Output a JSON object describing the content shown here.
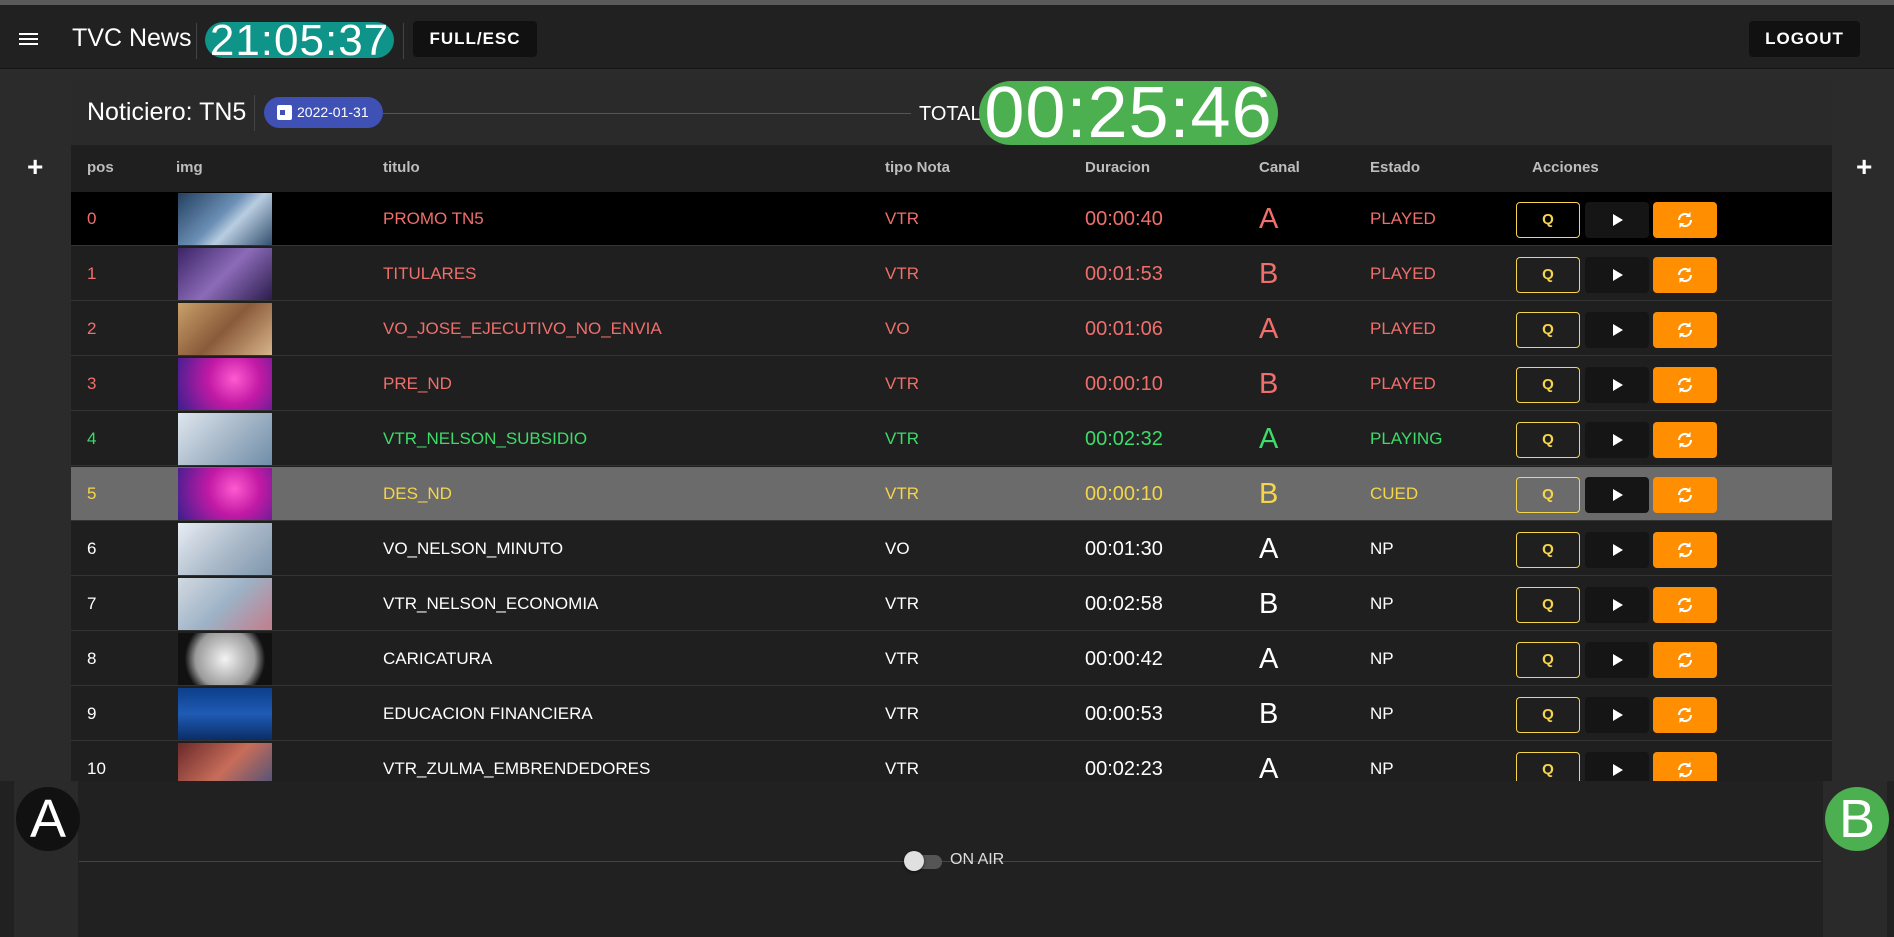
{
  "header": {
    "app_title": "TVC News",
    "clock": "21:05:37",
    "full_button": "FULL/ESC",
    "logout_button": "LOGOUT"
  },
  "side": {
    "add_left": "+",
    "add_right": "+"
  },
  "rundown": {
    "title": "Noticiero: TN5",
    "date": "2022-01-31",
    "total_label": "TOTAL",
    "total_time": "00:25:46",
    "columns": [
      "pos",
      "img",
      "titulo",
      "tipo Nota",
      "Duracion",
      "Canal",
      "Estado",
      "Acciones"
    ],
    "q_label": "Q",
    "rows": [
      {
        "pos": "0",
        "titulo": "PROMO TN5",
        "tipo": "VTR",
        "duracion": "00:00:40",
        "canal": "A",
        "estado": "PLAYED"
      },
      {
        "pos": "1",
        "titulo": "TITULARES",
        "tipo": "VTR",
        "duracion": "00:01:53",
        "canal": "B",
        "estado": "PLAYED"
      },
      {
        "pos": "2",
        "titulo": "VO_JOSE_EJECUTIVO_NO_ENVIA",
        "tipo": "VO",
        "duracion": "00:01:06",
        "canal": "A",
        "estado": "PLAYED"
      },
      {
        "pos": "3",
        "titulo": "PRE_ND",
        "tipo": "VTR",
        "duracion": "00:00:10",
        "canal": "B",
        "estado": "PLAYED"
      },
      {
        "pos": "4",
        "titulo": "VTR_NELSON_SUBSIDIO",
        "tipo": "VTR",
        "duracion": "00:02:32",
        "canal": "A",
        "estado": "PLAYING"
      },
      {
        "pos": "5",
        "titulo": "DES_ND",
        "tipo": "VTR",
        "duracion": "00:00:10",
        "canal": "B",
        "estado": "CUED"
      },
      {
        "pos": "6",
        "titulo": "VO_NELSON_MINUTO",
        "tipo": "VO",
        "duracion": "00:01:30",
        "canal": "A",
        "estado": "NP"
      },
      {
        "pos": "7",
        "titulo": "VTR_NELSON_ECONOMIA",
        "tipo": "VTR",
        "duracion": "00:02:58",
        "canal": "B",
        "estado": "NP"
      },
      {
        "pos": "8",
        "titulo": "CARICATURA",
        "tipo": "VTR",
        "duracion": "00:00:42",
        "canal": "A",
        "estado": "NP"
      },
      {
        "pos": "9",
        "titulo": "EDUCACION FINANCIERA",
        "tipo": "VTR",
        "duracion": "00:00:53",
        "canal": "B",
        "estado": "NP"
      },
      {
        "pos": "10",
        "titulo": "VTR_ZULMA_EMBRENDEDORES",
        "tipo": "VTR",
        "duracion": "00:02:23",
        "canal": "A",
        "estado": "NP"
      }
    ]
  },
  "footer": {
    "channel_a": "A",
    "channel_b": "B",
    "on_air_label": "ON AIR"
  },
  "colors": {
    "played": "#ef6f6c",
    "playing": "#3ddc6a",
    "cued": "#f5d54a",
    "np": "#ffffff",
    "clock_bg": "#0e9488",
    "total_bg": "#4caf50",
    "date_chip": "#3f51b5",
    "refresh_btn": "#ff8f00"
  },
  "icons": [
    "menu-icon",
    "calendar-icon",
    "play-icon",
    "refresh-icon"
  ]
}
